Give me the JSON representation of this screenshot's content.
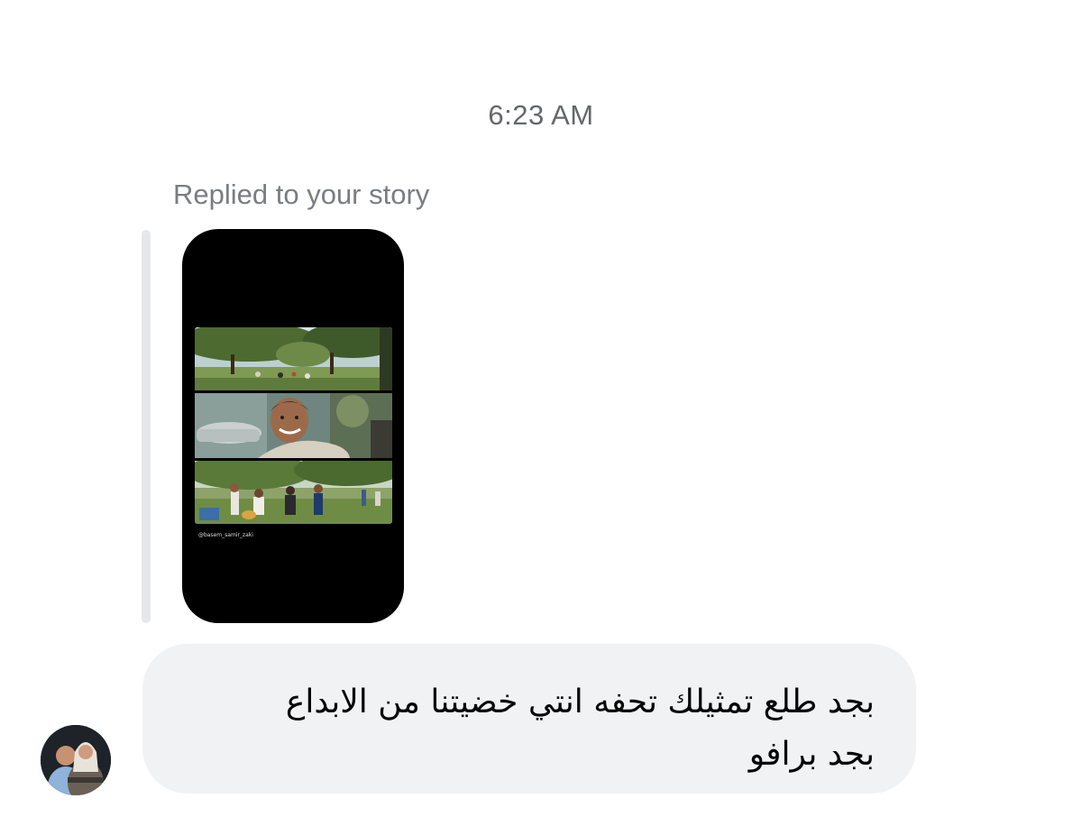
{
  "timestamp": "6:23 AM",
  "reply": {
    "label": "Replied to your story",
    "story_watermark": "@basem_samir_zaki"
  },
  "message": {
    "lines": [
      "بجد طلع تمثيلك تحفه انتي خضيتنا من الابداع",
      "بجد برافو"
    ]
  },
  "colors": {
    "bubble_bg": "#f1f2f4",
    "secondary_text": "#65676b",
    "reply_bar": "#e6e7ea",
    "story_bg": "#000000"
  },
  "icons": {
    "avatar": "sender-avatar"
  }
}
